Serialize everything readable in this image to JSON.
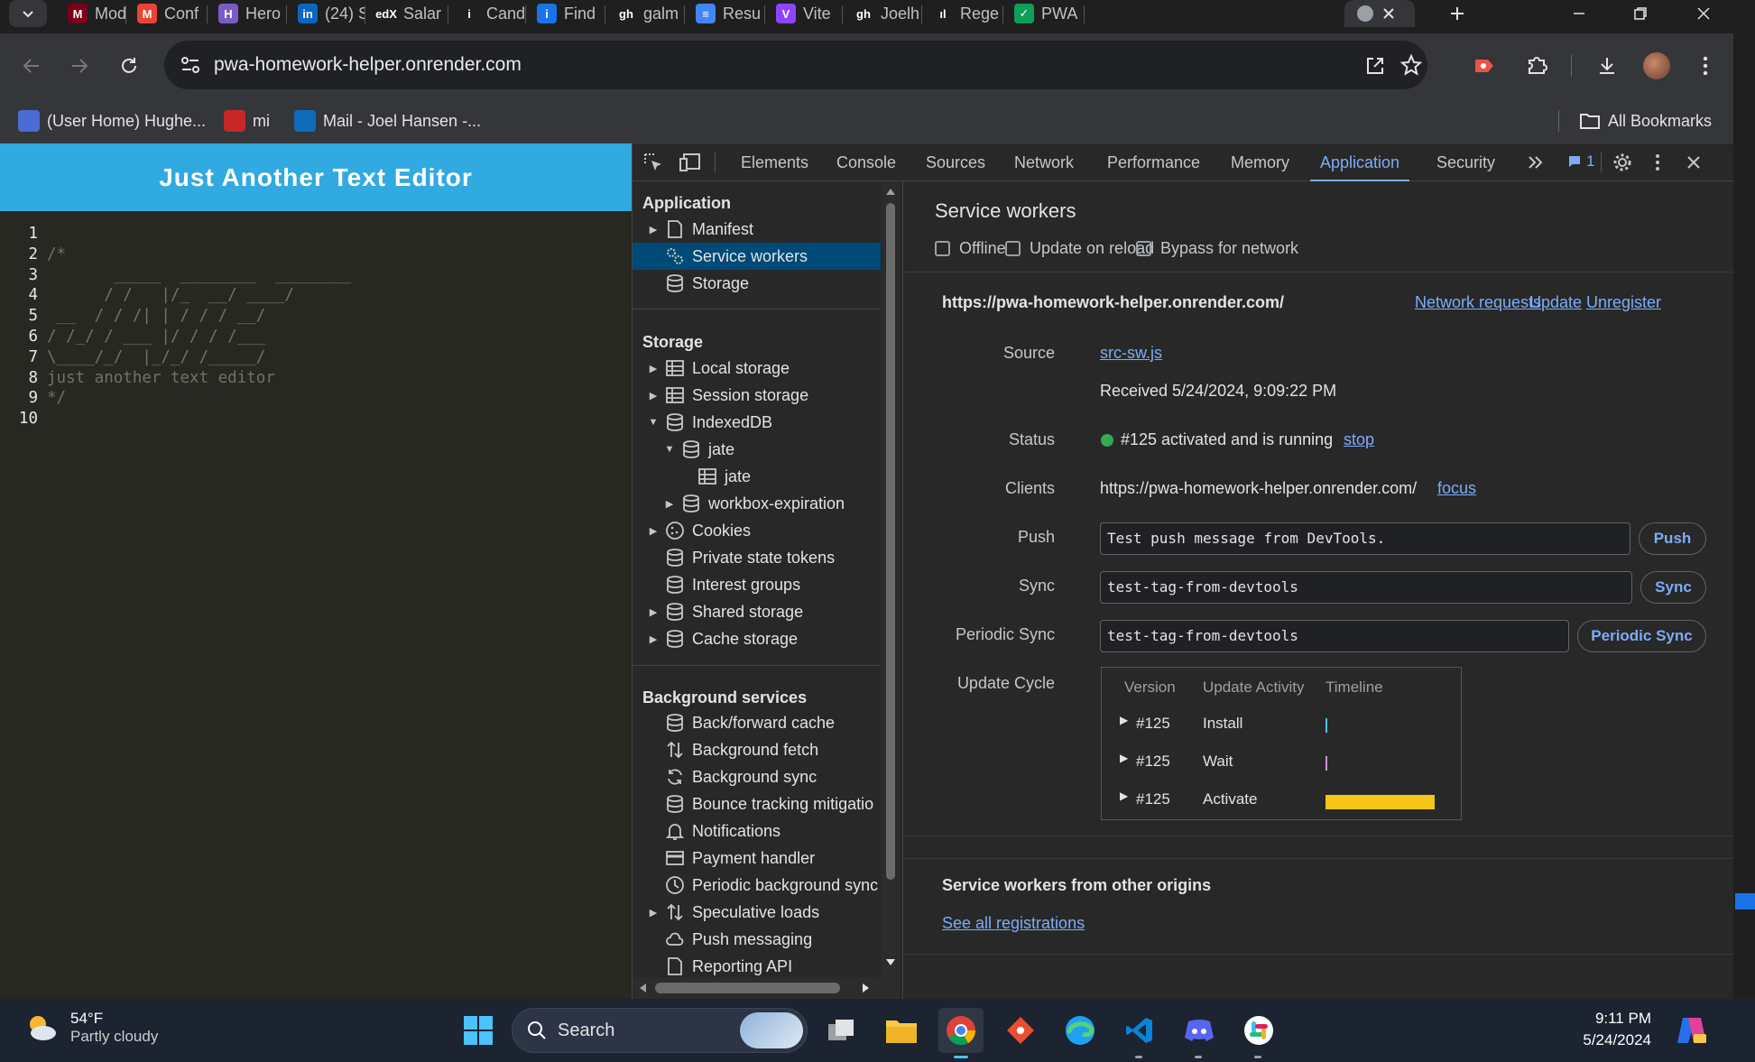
{
  "tabs": [
    {
      "label": "Mod",
      "color": "#7a0019",
      "glyph": "M"
    },
    {
      "label": "Conf",
      "color": "#ea4335",
      "glyph": "M"
    },
    {
      "label": "Hero",
      "color": "#7b5cc7",
      "glyph": "H"
    },
    {
      "label": "(24) S",
      "color": "#0a66c2",
      "glyph": "in"
    },
    {
      "label": "Salar",
      "color": "#1f1f1f",
      "glyph": "edX"
    },
    {
      "label": "Cand",
      "color": "#1f1f1f",
      "glyph": "i"
    },
    {
      "label": "Find",
      "color": "#1a73e8",
      "glyph": "i"
    },
    {
      "label": "galm",
      "color": "#1f1f1f",
      "glyph": "gh"
    },
    {
      "label": "Resu",
      "color": "#4285f4",
      "glyph": "≡"
    },
    {
      "label": "Vite",
      "color": "#8e44ff",
      "glyph": "V"
    },
    {
      "label": "Joelh",
      "color": "#1f1f1f",
      "glyph": "gh"
    },
    {
      "label": "Rege",
      "color": "#1f1f1f",
      "glyph": "ıl"
    },
    {
      "label": "PWA",
      "color": "#0f9d58",
      "glyph": "✓"
    }
  ],
  "address": {
    "url": "pwa-homework-helper.onrender.com"
  },
  "bookmarks": {
    "items": [
      "(User Home) Hughe...",
      "mi",
      "Mail - Joel Hansen -..."
    ],
    "all_bookmarks": "All Bookmarks"
  },
  "app": {
    "title": "Just Another Text Editor",
    "line_numbers": [
      "1",
      "2",
      "3",
      "4",
      "5",
      "6",
      "7",
      "8",
      "9",
      "10"
    ],
    "code_lines": [
      "",
      "/*",
      "       _____  ________  ________",
      "      / /   |/_  __/ ____/",
      " __  / / /| | / / / __/",
      "/ /_/ / ___ |/ / / /___",
      "\\____/_/  |_/_/ /_____/",
      "just another text editor",
      "*/",
      ""
    ]
  },
  "devtools": {
    "tabs": [
      "Elements",
      "Console",
      "Sources",
      "Network",
      "Performance",
      "Memory",
      "Application",
      "Security"
    ],
    "active_tab": "Application",
    "issues_count": "1",
    "sidebar": {
      "application_header": "Application",
      "application_items": [
        "Manifest",
        "Service workers",
        "Storage"
      ],
      "storage_header": "Storage",
      "storage_items": [
        "Local storage",
        "Session storage",
        "IndexedDB",
        "jate",
        "jate",
        "workbox-expiration",
        "Cookies",
        "Private state tokens",
        "Interest groups",
        "Shared storage",
        "Cache storage"
      ],
      "background_header": "Background services",
      "background_items": [
        "Back/forward cache",
        "Background fetch",
        "Background sync",
        "Bounce tracking mitigatio",
        "Notifications",
        "Payment handler",
        "Periodic background sync",
        "Speculative loads",
        "Push messaging",
        "Reporting API"
      ]
    },
    "sw": {
      "title": "Service workers",
      "checkboxes": [
        "Offline",
        "Update on reload",
        "Bypass for network"
      ],
      "origin": "https://pwa-homework-helper.onrender.com/",
      "links": [
        "Network requests",
        "Update",
        "Unregister"
      ],
      "source_label": "Source",
      "source_link": "src-sw.js",
      "received": "Received 5/24/2024, 9:09:22 PM",
      "status_label": "Status",
      "status_text": "#125 activated and is running",
      "status_link": "stop",
      "clients_label": "Clients",
      "clients_text": "https://pwa-homework-helper.onrender.com/",
      "clients_link": "focus",
      "push_label": "Push",
      "push_value": "Test push message from DevTools.",
      "push_btn": "Push",
      "sync_label": "Sync",
      "sync_value": "test-tag-from-devtools",
      "sync_btn": "Sync",
      "psync_label": "Periodic Sync",
      "psync_value": "test-tag-from-devtools",
      "psync_btn": "Periodic Sync",
      "cycle_label": "Update Cycle",
      "cycle_headers": [
        "Version",
        "Update Activity",
        "Timeline"
      ],
      "cycle_rows": [
        {
          "version": "#125",
          "activity": "Install"
        },
        {
          "version": "#125",
          "activity": "Wait"
        },
        {
          "version": "#125",
          "activity": "Activate"
        }
      ],
      "other_title": "Service workers from other origins",
      "other_link": "See all registrations"
    }
  },
  "taskbar": {
    "temp": "54°F",
    "weather": "Partly cloudy",
    "search": "Search",
    "time": "9:11 PM",
    "date": "5/24/2024"
  }
}
